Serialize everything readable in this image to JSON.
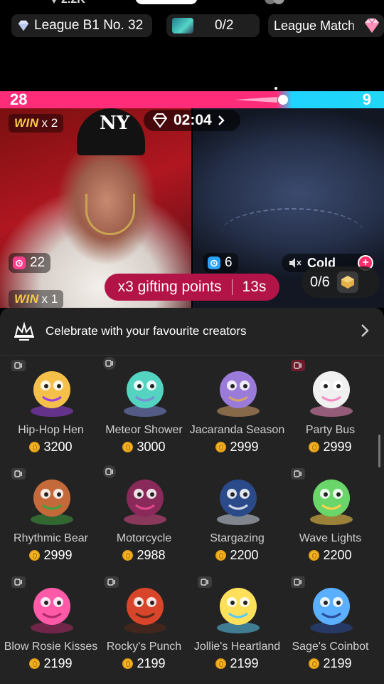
{
  "top_status": {
    "partial_count": "2.2K"
  },
  "chips": {
    "league": "League B1 No. 32",
    "progress": "0/2",
    "match": "League Match"
  },
  "battle": {
    "left_score": "28",
    "right_score": "9",
    "timer": "02:04",
    "left_win": {
      "label": "WIN",
      "count": "x 2"
    },
    "lower_win": {
      "label": "WIN",
      "count": "x 1"
    },
    "left_boost": "22",
    "right_boost": "6",
    "cold_label": "Cold",
    "gifting_points": "x3 gifting points",
    "gifting_timer": "13s",
    "box_progress": "0/6"
  },
  "panel": {
    "header": "Celebrate with your favourite creators",
    "gifts": [
      {
        "name": "Hip-Hop Hen",
        "price": "3200",
        "tag": "video-icon"
      },
      {
        "name": "Meteor Shower",
        "price": "3000",
        "tag": "sparkle-icon"
      },
      {
        "name": "Jacaranda Season",
        "price": "2999",
        "tag": ""
      },
      {
        "name": "Party Bus",
        "price": "2999",
        "tag": "clock-icon"
      },
      {
        "name": "Rhythmic Bear",
        "price": "2999",
        "tag": "video-icon"
      },
      {
        "name": "Motorcycle",
        "price": "2988",
        "tag": "palette-icon"
      },
      {
        "name": "Stargazing",
        "price": "2200",
        "tag": ""
      },
      {
        "name": "Wave Lights",
        "price": "2200",
        "tag": "video-icon"
      },
      {
        "name": "Blow Rosie Kisses",
        "price": "2199",
        "tag": "video-icon"
      },
      {
        "name": "Rocky's Punch",
        "price": "2199",
        "tag": "video-icon"
      },
      {
        "name": "Jollie's Heartland",
        "price": "2199",
        "tag": "video-icon"
      },
      {
        "name": "Sage's Coinbot",
        "price": "2199",
        "tag": "video-icon"
      }
    ]
  },
  "colors": {
    "pink": "#ff2c7a",
    "cyan": "#22d6f5",
    "gift_points_bg": "#b31448",
    "panel_bg": "#232323",
    "coin": "#f6b627"
  }
}
